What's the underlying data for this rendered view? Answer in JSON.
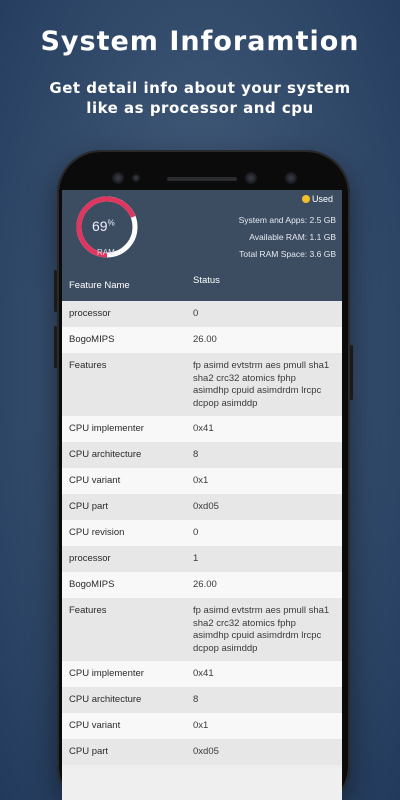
{
  "promo": {
    "title": "System Inforamtion",
    "subtitle_line1": "Get detail info about your system",
    "subtitle_line2": "like as processor and cpu"
  },
  "ram": {
    "percent": "69",
    "percent_unit": "%",
    "percent_value": 69,
    "label": "RAM",
    "legend": "Used",
    "stats": [
      {
        "label": "System and Apps:",
        "value": "2.5 GB"
      },
      {
        "label": "Available RAM:",
        "value": "1.1 GB"
      },
      {
        "label": "Total RAM Space:",
        "value": "3.6 GB"
      }
    ]
  },
  "colors": {
    "gauge_used": "#e0355f",
    "gauge_track": "#ffffff",
    "header_bg": "#3c4d62",
    "legend_dot": "#f3c02b"
  },
  "table": {
    "headers": {
      "feature": "Feature Name",
      "status": "Status"
    },
    "rows": [
      {
        "feature": "processor",
        "status": "0"
      },
      {
        "feature": "BogoMIPS",
        "status": "26.00"
      },
      {
        "feature": "Features",
        "status": "fp asimd evtstrm aes pmull sha1 sha2 crc32 atomics fphp asimdhp cpuid asimdrdm lrcpc dcpop asimddp"
      },
      {
        "feature": "CPU implementer",
        "status": "0x41"
      },
      {
        "feature": "CPU architecture",
        "status": "8"
      },
      {
        "feature": "CPU variant",
        "status": "0x1"
      },
      {
        "feature": "CPU part",
        "status": "0xd05"
      },
      {
        "feature": "CPU revision",
        "status": "0"
      },
      {
        "feature": "processor",
        "status": "1"
      },
      {
        "feature": "BogoMIPS",
        "status": "26.00"
      },
      {
        "feature": "Features",
        "status": "fp asimd evtstrm aes pmull sha1 sha2 crc32 atomics fphp asimdhp cpuid asimdrdm lrcpc dcpop asimddp"
      },
      {
        "feature": "CPU implementer",
        "status": "0x41"
      },
      {
        "feature": "CPU architecture",
        "status": "8"
      },
      {
        "feature": "CPU variant",
        "status": "0x1"
      },
      {
        "feature": "CPU part",
        "status": "0xd05"
      }
    ]
  }
}
